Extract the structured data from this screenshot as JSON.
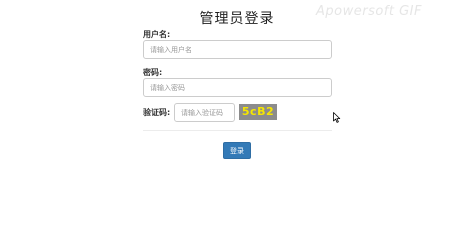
{
  "page": {
    "title": "管理员登录",
    "watermark": "Apowersoft GIF"
  },
  "form": {
    "username": {
      "label": "用户名:",
      "placeholder": "请输入用户名",
      "value": ""
    },
    "password": {
      "label": "密码:",
      "placeholder": "请输入密码",
      "value": ""
    },
    "captcha": {
      "label": "验证码:",
      "placeholder": "请输入验证码",
      "value": "",
      "image_text": "5cB2"
    },
    "submit_label": "登录"
  },
  "colors": {
    "button": "#337ab7",
    "captcha_background": "#8c8c8c",
    "captcha_text": "#f6e600"
  },
  "icons": {
    "cursor": "mouse-pointer-icon"
  }
}
